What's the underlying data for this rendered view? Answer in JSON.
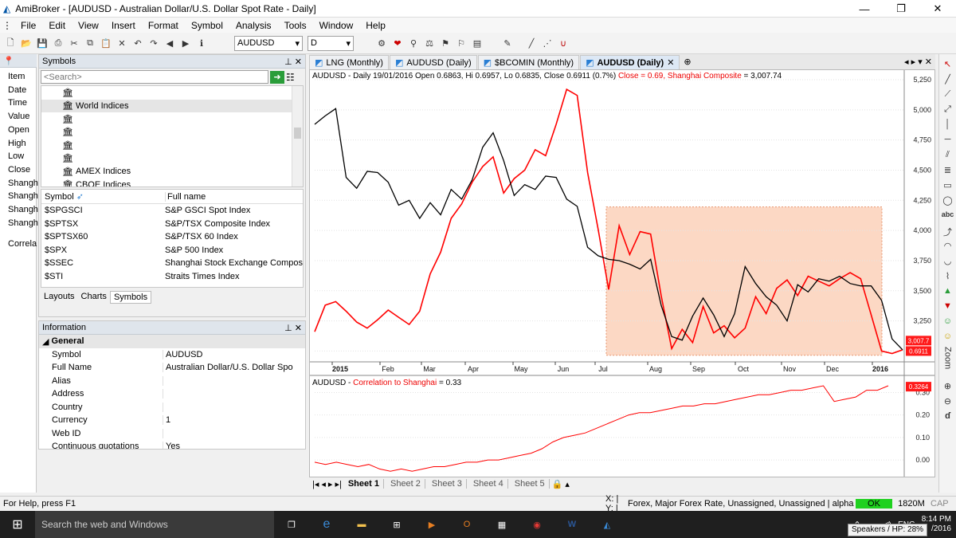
{
  "window": {
    "title": "AmiBroker - [AUDUSD - Australian Dollar/U.S. Dollar Spot Rate - Daily]",
    "min": "—",
    "max": "❐",
    "close": "✕"
  },
  "menu": [
    "File",
    "Edit",
    "View",
    "Insert",
    "Format",
    "Symbol",
    "Analysis",
    "Tools",
    "Window",
    "Help"
  ],
  "toolbar": {
    "symbol_value": "AUDUSD",
    "interval_value": "D"
  },
  "left_columns": [
    "Item",
    "Date",
    "Time",
    "Value",
    "Open",
    "High",
    "Low",
    "Close",
    "Shangh",
    "Shangh",
    "Shangh",
    "Shangh",
    "Correla"
  ],
  "symbols_panel": {
    "title": "Symbols",
    "search_placeholder": "<Search>",
    "tree": [
      "",
      "World Indices",
      "",
      "",
      "",
      "",
      "AMEX Indices",
      "CBOE Indices"
    ],
    "col_symbol": "Symbol",
    "col_fullname": "Full name",
    "rows": [
      {
        "symbol": "$SPGSCI",
        "name": "S&P GSCI Spot Index"
      },
      {
        "symbol": "$SPTSX",
        "name": "S&P/TSX Composite Index"
      },
      {
        "symbol": "$SPTSX60",
        "name": "S&P/TSX 60 Index"
      },
      {
        "symbol": "$SPX",
        "name": "S&P 500 Index"
      },
      {
        "symbol": "$SSEC",
        "name": "Shanghai Stock Exchange Compos"
      },
      {
        "symbol": "$STI",
        "name": "Straits Times Index"
      }
    ],
    "tabs": [
      "Layouts",
      "Charts",
      "Symbols"
    ]
  },
  "info_panel": {
    "title": "Information",
    "group": "General",
    "rows": [
      {
        "k": "Symbol",
        "v": "AUDUSD"
      },
      {
        "k": "Full Name",
        "v": "Australian Dollar/U.S. Dollar Spo"
      },
      {
        "k": "Alias",
        "v": ""
      },
      {
        "k": "Address",
        "v": ""
      },
      {
        "k": "Country",
        "v": ""
      },
      {
        "k": "Currency",
        "v": "1"
      },
      {
        "k": "Web ID",
        "v": ""
      },
      {
        "k": "Continuous quotations",
        "v": "Yes"
      }
    ]
  },
  "chart_tabs": [
    "LNG (Monthly)",
    "AUDUSD (Daily)",
    "$BCOMIN (Monthly)",
    "AUDUSD (Daily)"
  ],
  "sheets": [
    "Sheet 1",
    "Sheet 2",
    "Sheet 3",
    "Sheet 4",
    "Sheet 5"
  ],
  "chart_data": [
    {
      "type": "line",
      "title_main": "AUDUSD - Daily 19/01/2016 Open 0.6863, Hi 0.6957, Lo 0.6835, Close 0.6911 (0.7%) ",
      "title_close": "Close = 0.69, ",
      "title_shanghai": "Shanghai Composite",
      "title_shanghai_value": " = 3,007.74",
      "categories": [
        "2015",
        "Feb",
        "Mar",
        "Apr",
        "May",
        "Jun",
        "Jul",
        "Aug",
        "Sep",
        "Oct",
        "Nov",
        "Dec",
        "2016"
      ],
      "y_ticks": [
        "5,250",
        "5,000",
        "4,750",
        "4,500",
        "4,250",
        "4,000",
        "3,750",
        "3,500",
        "3,250",
        "3,000"
      ],
      "ylim": [
        2950,
        5250
      ],
      "label_shanghai": "3,007.7",
      "label_close": "0.6911",
      "series": [
        {
          "name": "Shanghai Composite",
          "color": "#ff0000",
          "values": [
            3160,
            3380,
            3410,
            3330,
            3240,
            3190,
            3260,
            3340,
            3280,
            3220,
            3330,
            3640,
            3820,
            4100,
            4220,
            4400,
            4530,
            4610,
            4310,
            4430,
            4500,
            4670,
            4620,
            4880,
            5170,
            5120,
            4480,
            4010,
            3510,
            4040,
            3800,
            3990,
            3970,
            3460,
            3020,
            3180,
            3070,
            3370,
            3150,
            3210,
            3110,
            3190,
            3450,
            3310,
            3520,
            3590,
            3460,
            3620,
            3580,
            3540,
            3600,
            3650,
            3600,
            3300,
            3000,
            2980,
            3010
          ]
        },
        {
          "name": "AUDUSD",
          "color": "#000000",
          "values": [
            4880,
            4950,
            5010,
            4440,
            4350,
            4490,
            4480,
            4400,
            4210,
            4250,
            4100,
            4230,
            4130,
            4340,
            4260,
            4420,
            4690,
            4810,
            4580,
            4290,
            4380,
            4340,
            4450,
            4440,
            4260,
            4200,
            3860,
            3790,
            3760,
            3750,
            3720,
            3680,
            3760,
            3380,
            3120,
            3090,
            3290,
            3440,
            3300,
            3120,
            3310,
            3700,
            3560,
            3450,
            3380,
            3250,
            3550,
            3490,
            3600,
            3580,
            3620,
            3560,
            3540,
            3540,
            3420,
            3100,
            3010
          ]
        }
      ]
    },
    {
      "type": "line",
      "title_symbol": "AUDUSD - ",
      "title_corr": "Correlation to Shanghai",
      "title_corr_value": " = 0.33",
      "y_ticks": [
        "0.30",
        "0.20",
        "0.10",
        "0.00"
      ],
      "ylim": [
        -0.06,
        0.33
      ],
      "label_corr": "0.3264",
      "series": [
        {
          "name": "Correlation to Shanghai",
          "color": "#ff0000",
          "values": [
            -0.01,
            -0.02,
            -0.01,
            -0.02,
            -0.03,
            -0.02,
            -0.04,
            -0.05,
            -0.04,
            -0.05,
            -0.04,
            -0.03,
            -0.03,
            -0.02,
            -0.01,
            -0.01,
            0.0,
            0.0,
            0.01,
            0.02,
            0.03,
            0.05,
            0.08,
            0.1,
            0.11,
            0.12,
            0.14,
            0.16,
            0.18,
            0.2,
            0.21,
            0.21,
            0.22,
            0.23,
            0.24,
            0.24,
            0.25,
            0.25,
            0.26,
            0.27,
            0.28,
            0.29,
            0.29,
            0.3,
            0.31,
            0.31,
            0.32,
            0.33,
            0.26,
            0.27,
            0.28,
            0.31,
            0.31,
            0.33
          ]
        }
      ]
    }
  ],
  "status": {
    "left": "For Help, press F1",
    "xy": "X: | Y: |",
    "info": "Forex, Major Forex Rate, Unassigned, Unassigned | alpha Test",
    "ok": "OK",
    "mem": "1820M",
    "cap": "CAP"
  },
  "taskbar": {
    "search": "Search the web and Windows",
    "time": "8:14 PM",
    "date": "/2016",
    "lang": "ENG",
    "tooltip": "Speakers / HP: 28%"
  }
}
